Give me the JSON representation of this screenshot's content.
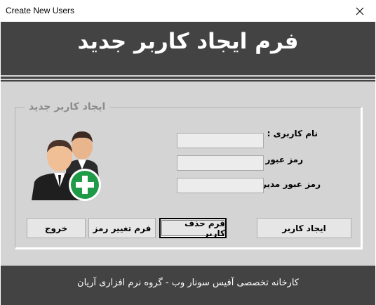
{
  "window": {
    "title": "Create New Users",
    "close_icon": "close-icon"
  },
  "header": {
    "title": "فرم ایجاد کاربر جدید"
  },
  "group": {
    "legend": "ایجاد کاربر جدید"
  },
  "fields": {
    "username_label": "نام کاربری :",
    "username_value": "",
    "password_label": "رمز عبور :",
    "password_value": "",
    "admin_password_label": "رمز عبور مدیر :",
    "admin_password_value": ""
  },
  "buttons": {
    "create_user": "ایجاد کاربر",
    "delete_user_form": "فرم حذف کاربر",
    "change_password_form": "فرم تغییر رمز",
    "exit": "خروج"
  },
  "icon": {
    "name": "users-add-icon"
  },
  "footer": {
    "text": "کارخانه تخصصی آفیس سونار وب - گروه نرم افزاری آریان"
  },
  "colors": {
    "header_bg": "#434343",
    "client_bg": "#d4d4d4",
    "plus_green": "#1f9a46"
  }
}
